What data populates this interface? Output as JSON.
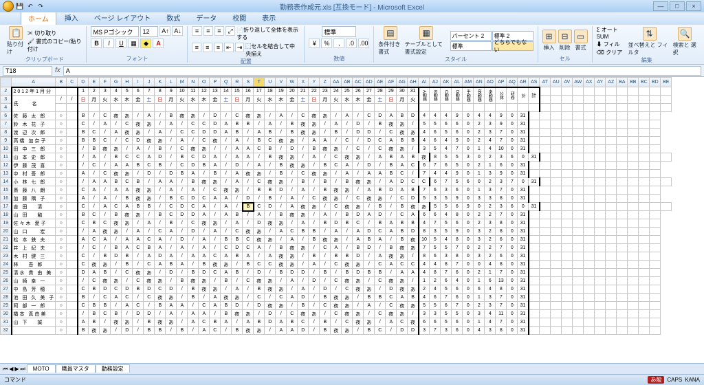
{
  "window": {
    "title": "勤務表作成元.xls [互換モード] - Microsoft Excel"
  },
  "tabs": [
    "ホーム",
    "挿入",
    "ページ レイアウト",
    "数式",
    "データ",
    "校閲",
    "表示"
  ],
  "activeTab": 0,
  "ribbon": {
    "clipboard": {
      "label": "クリップボード",
      "paste": "貼り付け",
      "cut": "切り取り",
      "copy": "書式のコピー/貼り付け"
    },
    "font": {
      "label": "フォント",
      "name": "MS Pゴシック",
      "size": "12"
    },
    "align": {
      "label": "配置",
      "wrap": "折り返して全体を表示する",
      "merge": "セルを結合して中央揃え"
    },
    "number": {
      "label": "数値",
      "format": "標準"
    },
    "styles": {
      "label": "スタイル",
      "condfmt": "条件付き\n書式",
      "tablefmt": "テーブルとして\n書式設定",
      "s1": "パーセント 2",
      "s2": "標準 2",
      "s3": "標準",
      "s4": "どちらでもない"
    },
    "cells": {
      "label": "セル",
      "insert": "挿入",
      "delete": "削除",
      "format": "書式"
    },
    "editing": {
      "label": "編集",
      "autosum": "オート SUM",
      "fill": "フィル",
      "clear": "クリア",
      "sort": "並べ替えと\nフィルタ",
      "find": "検索と\n選択"
    }
  },
  "namebox": "T18",
  "formula": "A",
  "period": "2012年1月分",
  "cols": [
    "A",
    "B",
    "C",
    "D",
    "E",
    "F",
    "G",
    "H",
    "I",
    "J",
    "K",
    "L",
    "M",
    "N",
    "O",
    "P",
    "Q",
    "R",
    "S",
    "T",
    "U",
    "V",
    "W",
    "X",
    "Y",
    "Z",
    "AA",
    "AB",
    "AC",
    "AD",
    "AE",
    "AF",
    "AG",
    "AH",
    "AI",
    "AJ",
    "AK",
    "AL",
    "AM",
    "AN",
    "AO",
    "AP",
    "AQ",
    "AR",
    "AS",
    "AT",
    "AU",
    "AV",
    "AW",
    "AX",
    "AY",
    "AZ",
    "BA",
    "BB",
    "BC",
    "BD",
    "BE"
  ],
  "days": [
    1,
    2,
    3,
    4,
    5,
    6,
    7,
    8,
    9,
    10,
    11,
    12,
    13,
    14,
    15,
    16,
    17,
    18,
    19,
    20,
    21,
    22,
    23,
    24,
    25,
    26,
    27,
    28,
    29,
    30,
    31
  ],
  "wdays": [
    "日",
    "月",
    "火",
    "水",
    "木",
    "金",
    "土",
    "日",
    "月",
    "火",
    "水",
    "木",
    "金",
    "土",
    "日",
    "月",
    "火",
    "水",
    "木",
    "金",
    "土",
    "日",
    "月",
    "火",
    "水",
    "木",
    "金",
    "土",
    "日",
    "月",
    "火"
  ],
  "wdayClass": [
    "red",
    "",
    "",
    "",
    "",
    "",
    "blue",
    "red",
    "",
    "",
    "",
    "",
    "",
    "blue",
    "red",
    "",
    "",
    "",
    "",
    "",
    "blue",
    "red",
    "",
    "",
    "",
    "",
    "",
    "blue",
    "red",
    "",
    "",
    ""
  ],
  "nameHeader": "氏　　名",
  "subhead": [
    "/",
    "/"
  ],
  "sumHead": [
    "A勤務",
    "B勤務",
    "C勤務",
    "D勤務",
    "半勤務",
    "夜勤務",
    "あ勤務",
    "公休",
    "研修",
    "計"
  ],
  "totalFixed": 31,
  "rows": [
    {
      "n": 6,
      "name": "佐 藤 太 郎",
      "d": [
        "B",
        "/",
        "C",
        "夜",
        "あ",
        "/",
        "A",
        "/",
        "B",
        "夜",
        "あ",
        "/",
        "D",
        "/",
        "C",
        "夜",
        "あ",
        "/",
        "A",
        "/",
        "C",
        "夜",
        "あ",
        "/",
        "A",
        "/",
        "C",
        "D",
        "A",
        "B",
        "D"
      ],
      "s": [
        4,
        4,
        4,
        9,
        0,
        4,
        4,
        9,
        0
      ]
    },
    {
      "n": 7,
      "name": "鈴 木 花 子",
      "d": [
        "C",
        "/",
        "A",
        "/",
        "C",
        "夜",
        "あ",
        "/",
        "A",
        "/",
        "C",
        "C",
        "D",
        "A",
        "B",
        "B",
        "/",
        "A",
        "/",
        "B",
        "夜",
        "あ",
        "/",
        "A",
        "/",
        "D",
        "/",
        "B",
        "夜",
        "あ",
        "/"
      ],
      "s": [
        5,
        5,
        6,
        6,
        0,
        2,
        3,
        9,
        0
      ]
    },
    {
      "n": 8,
      "name": "渡 辺 次 郎",
      "d": [
        "B",
        "C",
        "/",
        "A",
        "夜",
        "あ",
        "/",
        "A",
        "/",
        "C",
        "C",
        "D",
        "D",
        "A",
        "B",
        "/",
        "A",
        "B",
        "/",
        "B",
        "夜",
        "あ",
        "/",
        "B",
        "/",
        "D",
        "D",
        "/",
        "C",
        "夜",
        "あ"
      ],
      "s": [
        4,
        6,
        5,
        6,
        0,
        2,
        3,
        7,
        0
      ]
    },
    {
      "n": 9,
      "name": "高橋 加奈子",
      "d": [
        "B",
        "B",
        "C",
        "/",
        "C",
        "D",
        "夜",
        "あ",
        "/",
        "A",
        "/",
        "C",
        "夜",
        "/",
        "A",
        "/",
        "B",
        "C",
        "夜",
        "あ",
        "/",
        "A",
        "A",
        "/",
        "C",
        "/",
        "D",
        "C",
        "A",
        "B",
        "B"
      ],
      "s": [
        4,
        6,
        4,
        9,
        0,
        2,
        4,
        7,
        0
      ]
    },
    {
      "n": 10,
      "name": "田 中 三 郎",
      "d": [
        "/",
        "B",
        "夜",
        "あ",
        "/",
        "A",
        "/",
        "B",
        "/",
        "C",
        "夜",
        "あ",
        "/",
        "/",
        "A",
        "A",
        "C",
        "B",
        "/",
        "D",
        "/",
        "B",
        "夜",
        "あ",
        "/",
        "C",
        "/",
        "C",
        "夜",
        "あ",
        "/"
      ],
      "s": [
        3,
        5,
        4,
        7,
        0,
        1,
        4,
        10,
        0
      ]
    },
    {
      "n": 11,
      "name": "山 本 史 郎",
      "d": [
        "/",
        "A",
        "/",
        "B",
        "C",
        "C",
        "A",
        "D",
        "/",
        "B",
        "C",
        "D",
        "A",
        "/",
        "A",
        "A",
        "/",
        "B",
        "夜",
        "あ",
        "/",
        "A",
        "/",
        "C",
        "夜",
        "あ",
        "/",
        "A",
        "B",
        "A",
        "B",
        "夜"
      ],
      "s": [
        8,
        5,
        5,
        3,
        0,
        2,
        3,
        6,
        0
      ]
    },
    {
      "n": 12,
      "name": "伊 藤 茂 喜",
      "d": [
        "/",
        "C",
        "/",
        "A",
        "A",
        "B",
        "C",
        "B",
        "/",
        "C",
        "D",
        "B",
        "A",
        "/",
        "D",
        "/",
        "A",
        "/",
        "B",
        "夜",
        "あ",
        "/",
        "B",
        "C",
        "A",
        "/",
        "D",
        "/",
        "B",
        "A",
        "C"
      ],
      "s": [
        6,
        7,
        6,
        5,
        0,
        2,
        1,
        6,
        0
      ]
    },
    {
      "n": 13,
      "name": "中 村 吾 郎",
      "d": [
        "A",
        "/",
        "C",
        "夜",
        "あ",
        "/",
        "D",
        "/",
        "D",
        "B",
        "A",
        "/",
        "B",
        "/",
        "A",
        "夜",
        "あ",
        "/",
        "B",
        "/",
        "C",
        "夜",
        "あ",
        "/",
        "A",
        "/",
        "A",
        "A",
        "B",
        "C",
        "/"
      ],
      "s": [
        7,
        4,
        4,
        9,
        0,
        1,
        3,
        9,
        0
      ]
    },
    {
      "n": 14,
      "name": "小 林 七 郎",
      "d": [
        "/",
        "A",
        "A",
        "B",
        "C",
        "B",
        "/",
        "A",
        "A",
        "/",
        "B",
        "夜",
        "あ",
        "/",
        "A",
        "/",
        "C",
        "夜",
        "あ",
        "/",
        "B",
        "/",
        "B",
        "/",
        "B",
        "夜",
        "あ",
        "/",
        "A",
        "D",
        "C",
        "C"
      ],
      "s": [
        6,
        7,
        5,
        6,
        0,
        2,
        3,
        7,
        0
      ]
    },
    {
      "n": 15,
      "name": "斎 藤 八 朗",
      "d": [
        "C",
        "A",
        "/",
        "A",
        "A",
        "夜",
        "あ",
        "/",
        "A",
        "/",
        "A",
        "/",
        "C",
        "夜",
        "あ",
        "/",
        "B",
        "B",
        "D",
        "/",
        "A",
        "/",
        "B",
        "夜",
        "あ",
        "/",
        "A",
        "B",
        "D",
        "A",
        "B"
      ],
      "s": [
        7,
        6,
        3,
        6,
        0,
        1,
        3,
        7,
        0
      ]
    },
    {
      "n": 16,
      "name": "加 藤 隅 子",
      "d": [
        "A",
        "/",
        "A",
        "/",
        "B",
        "夜",
        "あ",
        "/",
        "B",
        "C",
        "D",
        "C",
        "A",
        "A",
        "/",
        "D",
        "/",
        "B",
        "/",
        "A",
        "/",
        "C",
        "夜",
        "あ",
        "/",
        "C",
        "夜",
        "あ",
        "/",
        "C",
        "D"
      ],
      "s": [
        5,
        3,
        5,
        9,
        0,
        3,
        3,
        8,
        0
      ]
    },
    {
      "n": 17,
      "name": "吉 田　 清",
      "d": [
        "C",
        "/",
        "A",
        "C",
        "A",
        "B",
        "B",
        "/",
        "C",
        "D",
        "C",
        "A",
        "/",
        "A",
        "/",
        "B",
        "C",
        "D",
        "/",
        "A",
        "夜",
        "あ",
        "/",
        "C",
        "夜",
        "あ",
        "/",
        "B",
        "/",
        "B",
        "夜",
        "あ"
      ],
      "s": [
        5,
        5,
        6,
        9,
        0,
        2,
        3,
        6,
        0
      ]
    },
    {
      "n": 18,
      "name": "山 田　 勉",
      "d": [
        "B",
        "C",
        "/",
        "B",
        "夜",
        "あ",
        "/",
        "B",
        "C",
        "D",
        "D",
        "A",
        "/",
        "A",
        "B",
        "/",
        "A",
        "/",
        "B",
        "夜",
        "あ",
        "/",
        "A",
        "/",
        "B",
        "D",
        "A",
        "D",
        "/",
        "C",
        "A"
      ],
      "s": [
        6,
        6,
        4,
        8,
        0,
        2,
        2,
        7,
        0
      ]
    },
    {
      "n": 19,
      "name": "佐々木 愛子",
      "d": [
        "C",
        "B",
        "C",
        "夜",
        "あ",
        "/",
        "A",
        "/",
        "B",
        "/",
        "C",
        "夜",
        "あ",
        "/",
        "A",
        "/",
        "D",
        "夜",
        "あ",
        "/",
        "A",
        "/",
        "B",
        "D",
        "B",
        "C",
        "/",
        "B",
        "A",
        "B",
        "B"
      ],
      "s": [
        4,
        7,
        5,
        6,
        0,
        2,
        3,
        8,
        0
      ]
    },
    {
      "n": 20,
      "name": "山 口 　 宏",
      "d": [
        "/",
        "A",
        "夜",
        "あ",
        "/",
        "A",
        "/",
        "C",
        "A",
        "/",
        "D",
        "/",
        "A",
        "/",
        "C",
        "夜",
        "あ",
        "/",
        "A",
        "C",
        "B",
        "B",
        "/",
        "A",
        "/",
        "A",
        "D",
        "C",
        "A",
        "B",
        "D"
      ],
      "s": [
        8,
        3,
        5,
        9,
        0,
        3,
        2,
        8,
        0
      ]
    },
    {
      "n": 21,
      "name": "松 本 鉄 夫",
      "d": [
        "A",
        "C",
        "A",
        "/",
        "A",
        "A",
        "C",
        "A",
        "/",
        "D",
        "/",
        "A",
        "/",
        "B",
        "B",
        "C",
        "夜",
        "あ",
        "/",
        "A",
        "/",
        "B",
        "夜",
        "あ",
        "/",
        "A",
        "B",
        "A",
        "/",
        "B",
        "夜"
      ],
      "s": [
        10,
        5,
        4,
        8,
        0,
        3,
        2,
        6,
        0
      ]
    },
    {
      "n": 22,
      "name": "井 上 紀 夫",
      "d": [
        "/",
        "C",
        "/",
        "B",
        "A",
        "C",
        "B",
        "A",
        "/",
        "A",
        "/",
        "A",
        "/",
        "C",
        "D",
        "C",
        "A",
        "/",
        "B",
        "夜",
        "あ",
        "/",
        "C",
        "A",
        "/",
        "B",
        "D",
        "/",
        "B",
        "夜",
        "あ"
      ],
      "s": [
        7,
        5,
        5,
        7,
        0,
        2,
        2,
        7,
        0
      ]
    },
    {
      "n": 23,
      "name": "木 村 健 三",
      "d": [
        "C",
        "/",
        "B",
        "D",
        "B",
        "/",
        "A",
        "D",
        "A",
        "/",
        "A",
        "A",
        "C",
        "A",
        "B",
        "A",
        "/",
        "A",
        "夜",
        "あ",
        "/",
        "B",
        "/",
        "B",
        "B",
        "D",
        "/",
        "A",
        "夜",
        "あ",
        "/"
      ],
      "s": [
        8,
        6,
        3,
        8,
        0,
        3,
        2,
        6,
        0
      ]
    },
    {
      "n": 24,
      "name": "林  　吾 郎",
      "d": [
        "C",
        "夜",
        "あ",
        "/",
        "B",
        "/",
        "C",
        "A",
        "B",
        "A",
        "/",
        "B",
        "夜",
        "あ",
        "/",
        "B",
        "C",
        "C",
        "夜",
        "あ",
        "/",
        "A",
        "/",
        "C",
        "夜",
        "あ",
        "/",
        "C",
        "A",
        "C",
        "C"
      ],
      "s": [
        4,
        4,
        8,
        7,
        0,
        0,
        4,
        8,
        0
      ]
    },
    {
      "n": 25,
      "name": "清水 貫 由 美",
      "d": [
        "D",
        "A",
        "B",
        "/",
        "C",
        "夜",
        "あ",
        "/",
        "D",
        "/",
        "B",
        "D",
        "C",
        "A",
        "B",
        "/",
        "D",
        "/",
        "B",
        "D",
        "D",
        "/",
        "B",
        "/",
        "B",
        "D",
        "B",
        "B",
        "/",
        "A",
        "A"
      ],
      "s": [
        4,
        8,
        7,
        6,
        0,
        2,
        1,
        7,
        0
      ]
    },
    {
      "n": 26,
      "name": "山 崎 幸 一",
      "d": [
        "/",
        "C",
        "夜",
        "あ",
        "/",
        "C",
        "夜",
        "あ",
        "/",
        "B",
        "夜",
        "あ",
        "/",
        "B",
        "/",
        "C",
        "夜",
        "あ",
        "/",
        "A",
        "/",
        "D",
        "/",
        "C",
        "夜",
        "あ",
        "/",
        "C",
        "夜",
        "あ",
        "/"
      ],
      "s": [
        1,
        2,
        6,
        4,
        0,
        1,
        6,
        13,
        0
      ]
    },
    {
      "n": 27,
      "name": "中 島 芳 穂",
      "d": [
        "C",
        "B",
        "D",
        "C",
        "D",
        "B",
        "D",
        "C",
        "D",
        "/",
        "B",
        "夜",
        "あ",
        "/",
        "A",
        "/",
        "B",
        "夜",
        "あ",
        "/",
        "A",
        "/",
        "D",
        "/",
        "C",
        "夜",
        "あ",
        "/",
        "D",
        "夜",
        "あ"
      ],
      "s": [
        2,
        4,
        5,
        6,
        0,
        6,
        4,
        8,
        0
      ]
    },
    {
      "n": 28,
      "name": "池 田 久 美 子",
      "d": [
        "B",
        "/",
        "C",
        "A",
        "C",
        "/",
        "C",
        "夜",
        "あ",
        "/",
        "B",
        "/",
        "A",
        "夜",
        "あ",
        "/",
        "C",
        "/",
        "C",
        "A",
        "D",
        "/",
        "B",
        "夜",
        "あ",
        "/",
        "B",
        "B",
        "C",
        "A",
        "B"
      ],
      "s": [
        4,
        6,
        7,
        6,
        0,
        1,
        3,
        7,
        0
      ]
    },
    {
      "n": 29,
      "name": "阿 部 一 郎",
      "d": [
        "C",
        "B",
        "B",
        "/",
        "A",
        "C",
        "/",
        "B",
        "A",
        "A",
        "/",
        "C",
        "A",
        "B",
        "D",
        "/",
        "D",
        "夜",
        "あ",
        "/",
        "B",
        "/",
        "C",
        "夜",
        "あ",
        "/",
        "A",
        "/",
        "C",
        "夜",
        "あ"
      ],
      "s": [
        5,
        5,
        6,
        7,
        0,
        2,
        3,
        7,
        0
      ]
    },
    {
      "n": 30,
      "name": "橋本 真由美",
      "d": [
        "/",
        "B",
        "C",
        "B",
        "/",
        "D",
        "D",
        "/",
        "A",
        "/",
        "A",
        "A",
        "/",
        "B",
        "夜",
        "あ",
        "/",
        "D",
        "/",
        "C",
        "夜",
        "あ",
        "/",
        "C",
        "夜",
        "あ",
        "/",
        "C",
        "夜",
        "あ",
        "/"
      ],
      "s": [
        3,
        3,
        5,
        5,
        0,
        3,
        4,
        11,
        0
      ]
    },
    {
      "n": 31,
      "name": "山 下  　誠",
      "d": [
        "A",
        "B",
        "/",
        "夜",
        "あ",
        "/",
        "B",
        "夜",
        "あ",
        "/",
        "A",
        "C",
        "B",
        "A",
        "/",
        "A",
        "B",
        "D",
        "A",
        "B",
        "C",
        "/",
        "B",
        "/",
        "C",
        "夜",
        "あ",
        "/",
        "A",
        "C",
        "夜"
      ],
      "s": [
        6,
        6,
        5,
        6,
        0,
        1,
        4,
        7,
        0
      ]
    },
    {
      "n": 32,
      "name": "",
      "d": [
        "B",
        "夜",
        "あ",
        "/",
        "D",
        "/",
        "B",
        "B",
        "/",
        "B",
        "/",
        "A",
        "C",
        "/",
        "B",
        "夜",
        "あ",
        "/",
        "A",
        "A",
        "D",
        "/",
        "B",
        "夜",
        "あ",
        "/",
        "B",
        "C",
        "/",
        "D",
        "D"
      ],
      "s": [
        3,
        7,
        3,
        6,
        0,
        4,
        3,
        8,
        0
      ]
    }
  ],
  "sheetTabs": [
    "MOTO",
    "職員マスタ",
    "勤務設定"
  ],
  "status": {
    "left": "コマンド",
    "ime": "あ般",
    "caps": "CAPS",
    "kana": "KANA"
  },
  "selCell": {
    "row": 17,
    "col": 19
  }
}
